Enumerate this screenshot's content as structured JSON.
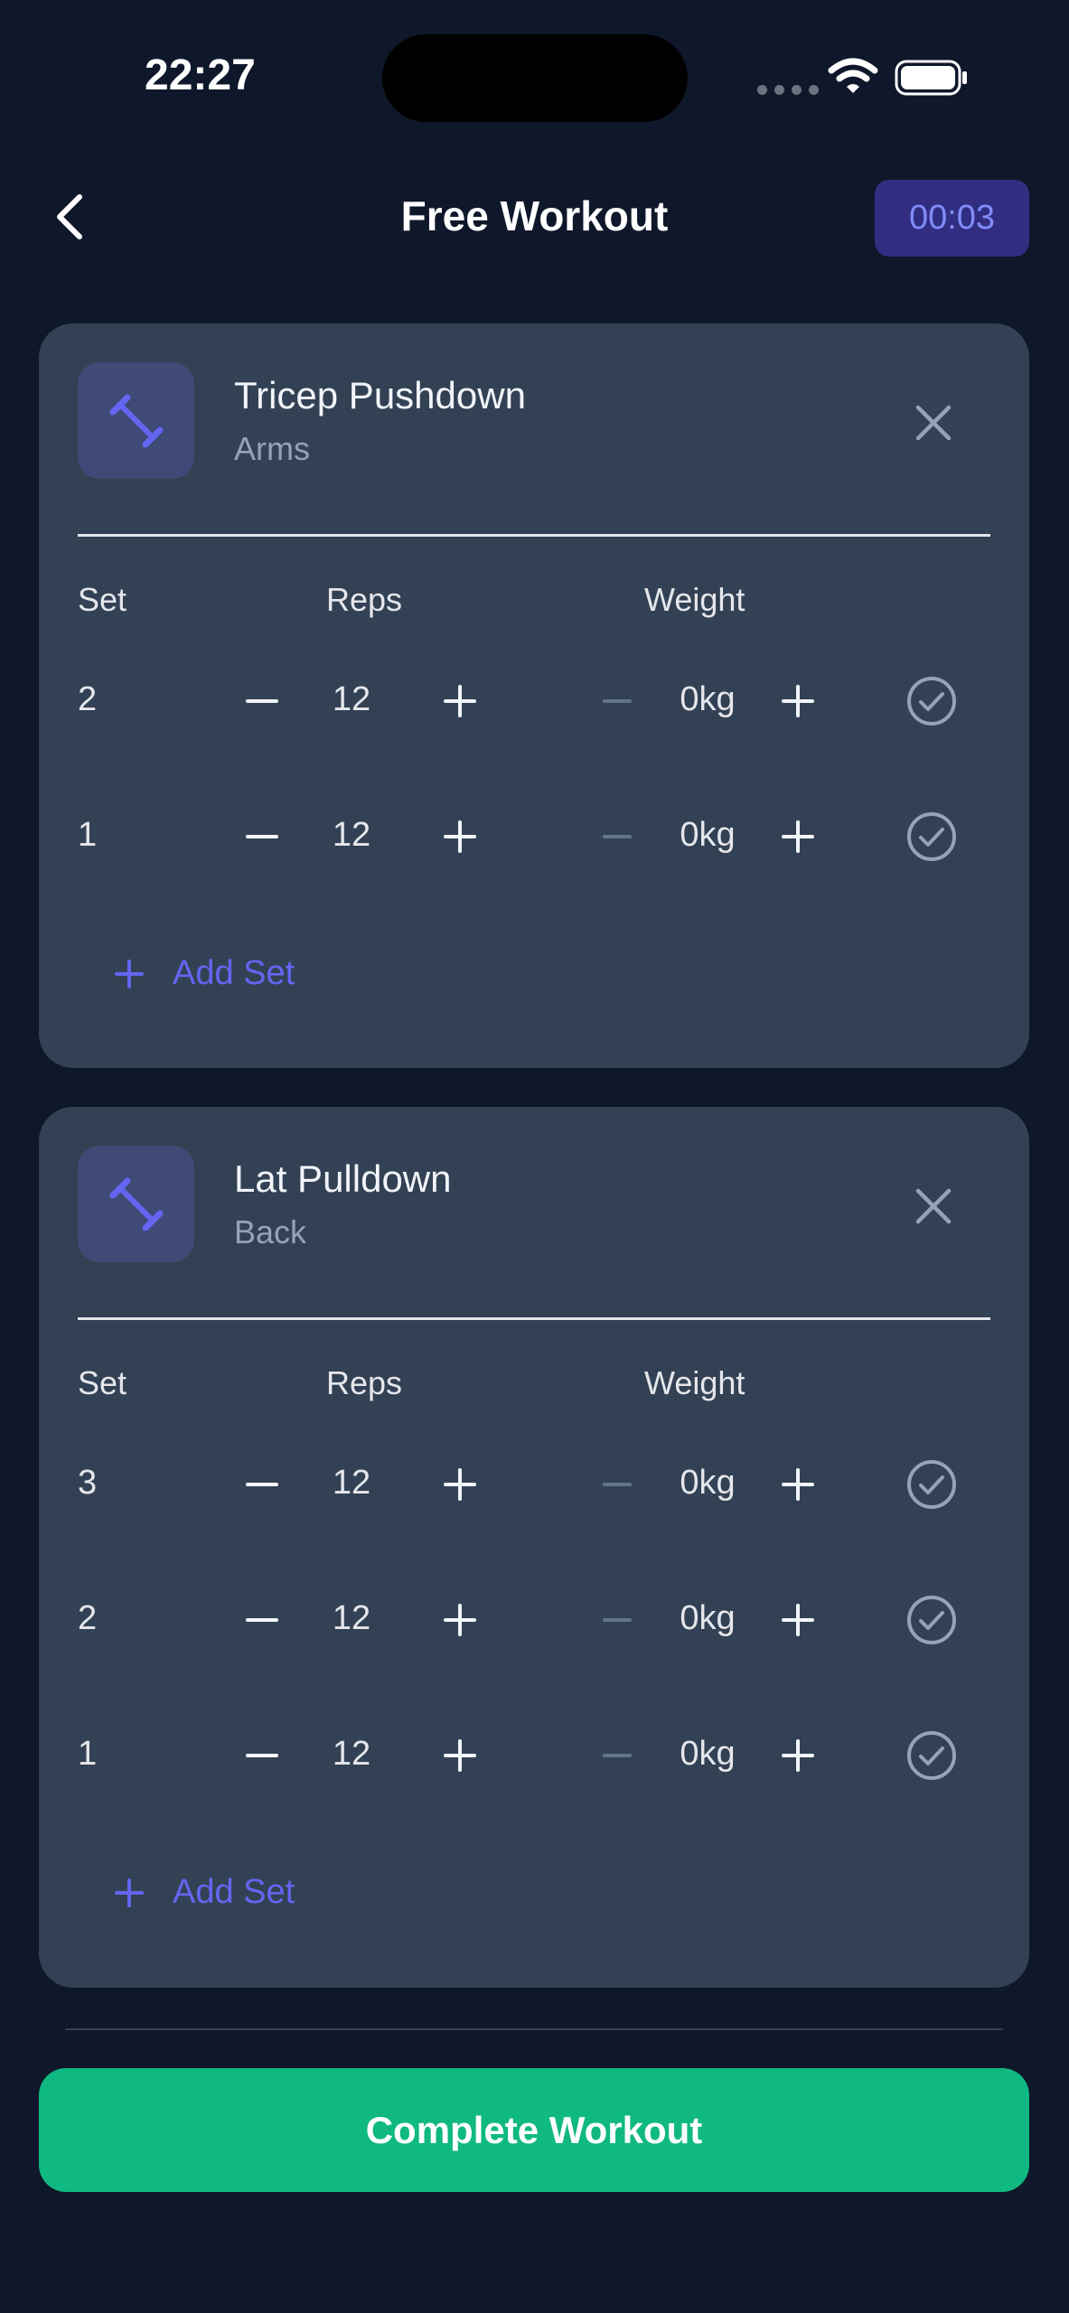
{
  "status_bar": {
    "time": "22:27"
  },
  "header": {
    "title": "Free Workout",
    "timer": "00:03"
  },
  "columns": {
    "set": "Set",
    "reps": "Reps",
    "weight": "Weight"
  },
  "exercises": [
    {
      "name": "Tricep Pushdown",
      "group": "Arms",
      "sets": [
        {
          "set": "2",
          "reps": "12",
          "weight": "0kg"
        },
        {
          "set": "1",
          "reps": "12",
          "weight": "0kg"
        }
      ],
      "add_set_label": "Add Set"
    },
    {
      "name": "Lat Pulldown",
      "group": "Back",
      "sets": [
        {
          "set": "3",
          "reps": "12",
          "weight": "0kg"
        },
        {
          "set": "2",
          "reps": "12",
          "weight": "0kg"
        },
        {
          "set": "1",
          "reps": "12",
          "weight": "0kg"
        }
      ],
      "add_set_label": "Add Set"
    }
  ],
  "footer": {
    "complete_label": "Complete Workout"
  },
  "colors": {
    "background": "#0f172a",
    "card": "#334155",
    "accent": "#6366f1",
    "success": "#10b981"
  }
}
